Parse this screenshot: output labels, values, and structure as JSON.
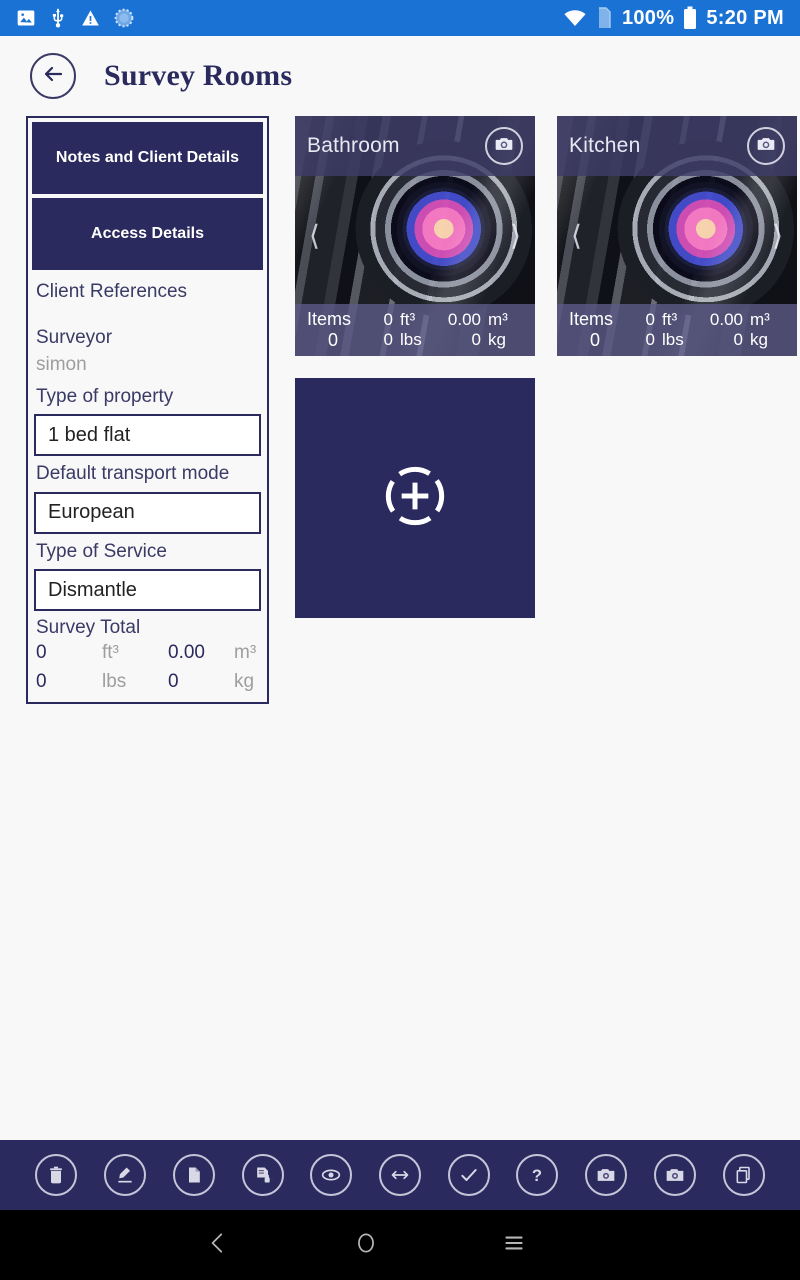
{
  "statusbar": {
    "icons_left": [
      "image-icon",
      "usb-icon",
      "warning-triangle-icon",
      "sync-circle-icon"
    ],
    "icons_right": [
      "wifi-icon",
      "sim-card-icon"
    ],
    "battery_percent": "100%",
    "battery_icon": "battery-full-icon",
    "time": "5:20 PM"
  },
  "appbar": {
    "back_icon": "back-arrow-icon",
    "title": "Survey Rooms"
  },
  "info_panel": {
    "buttons": [
      {
        "label": "Notes and Client Details"
      },
      {
        "label": "Access Details"
      }
    ],
    "section_title": "Client References",
    "fields": [
      {
        "label": "Surveyor",
        "value": "simon",
        "type": "text-readonly"
      },
      {
        "label": "Type of property",
        "value": "1 bed flat",
        "type": "input"
      },
      {
        "label": "Default transport mode",
        "value": "European",
        "type": "input"
      },
      {
        "label": "Type of Service",
        "value": "Dismantle",
        "type": "input"
      }
    ],
    "totals": {
      "title": "Survey Total",
      "row1": {
        "value": "0",
        "unit": "ft³",
        "value2": "0.00",
        "unit2": "m³"
      },
      "row2": {
        "value": "0",
        "unit": "lbs",
        "value2": "0",
        "unit2": "kg"
      }
    }
  },
  "rooms": [
    {
      "name": "Bathroom",
      "camera_icon": "camera-icon",
      "prev_icon": "chevron-left-icon",
      "next_icon": "chevron-right-icon",
      "items_label": "Items",
      "items_count": "0",
      "volume_ft": "0",
      "volume_ft_unit": "ft³",
      "volume_m": "0.00",
      "volume_m_unit": "m³",
      "weight_lbs": "0",
      "weight_lbs_unit": "lbs",
      "weight_kg": "0",
      "weight_kg_unit": "kg"
    },
    {
      "name": "Kitchen",
      "camera_icon": "camera-icon",
      "prev_icon": "chevron-left-icon",
      "next_icon": "chevron-right-icon",
      "items_label": "Items",
      "items_count": "0",
      "volume_ft": "0",
      "volume_ft_unit": "ft³",
      "volume_m": "0.00",
      "volume_m_unit": "m³",
      "weight_lbs": "0",
      "weight_lbs_unit": "lbs",
      "weight_kg": "0",
      "weight_kg_unit": "kg"
    }
  ],
  "add_room": {
    "icon": "add-room-target-icon"
  },
  "toolbar": {
    "items": [
      {
        "icon": "trash-icon"
      },
      {
        "icon": "signature-pen-icon"
      },
      {
        "icon": "document-icon"
      },
      {
        "icon": "document-lock-icon"
      },
      {
        "icon": "eye-icon"
      },
      {
        "icon": "resize-horizontal-icon"
      },
      {
        "icon": "check-icon"
      },
      {
        "icon": "help-question-icon"
      },
      {
        "icon": "camera-icon"
      },
      {
        "icon": "camera-alt-icon"
      },
      {
        "icon": "copy-pages-icon"
      }
    ]
  },
  "navbar": {
    "back_icon": "nav-back-icon",
    "home_icon": "nav-home-icon",
    "recents_icon": "nav-recents-icon"
  },
  "colors": {
    "status_blue": "#1a73d4",
    "navy": "#2a2a5e",
    "page_bg": "#f8f8f8",
    "muted_text": "#9e9e9e",
    "card_header_overlay": "#3e3c68"
  }
}
